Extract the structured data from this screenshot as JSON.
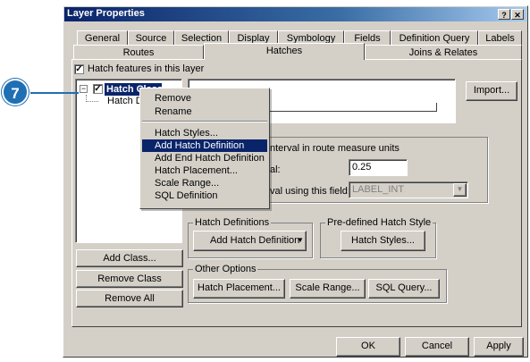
{
  "window": {
    "title": "Layer Properties",
    "help_button": "?",
    "close_button": "✕"
  },
  "tabs_row1": [
    "General",
    "Source",
    "Selection",
    "Display",
    "Symbology",
    "Fields",
    "Definition Query",
    "Labels"
  ],
  "tabs_row2": [
    "Routes",
    "Hatches",
    "Joins & Relates"
  ],
  "hatch_features_checkbox": {
    "label": "Hatch features in this layer",
    "checked": "☑"
  },
  "callout": {
    "number": "7"
  },
  "tree": {
    "root_label": "Hatch Class",
    "child_label": "Hatch Def",
    "expand_symbol": "−",
    "checked_symbol": "✓"
  },
  "buttons": {
    "import": "Import...",
    "add_class": "Add Class...",
    "remove_class": "Remove Class",
    "remove_all": "Remove All",
    "add_hatch_definition": "Add Hatch Definition",
    "hatch_styles": "Hatch Styles...",
    "hatch_placement": "Hatch Placement...",
    "scale_range": "Scale Range...",
    "sql_query": "SQL Query...",
    "ok": "OK",
    "cancel": "Cancel",
    "apply": "Apply"
  },
  "interval_group": {
    "text_partial": "nterval in route measure units",
    "interval_label_partial": "al:",
    "interval_value": "0.25",
    "field_label_partial": "val using this field:",
    "field_value": "LABEL_INT"
  },
  "groups": {
    "hatch_definitions": "Hatch Definitions",
    "predefined_style": "Pre-defined Hatch Style",
    "other_options": "Other Options"
  },
  "context_menu": {
    "items": [
      "Remove",
      "Rename",
      "Hatch Styles...",
      "Add Hatch Definition",
      "Add End Hatch Definition",
      "Hatch Placement...",
      "Scale Range...",
      "SQL Definition"
    ],
    "selected": "Add Hatch Definition"
  },
  "colors": {
    "title_bar": "#0a246a",
    "callout": "#1f6fb5",
    "selection": "#0a246a",
    "dialog_face": "#d4d0c8"
  }
}
